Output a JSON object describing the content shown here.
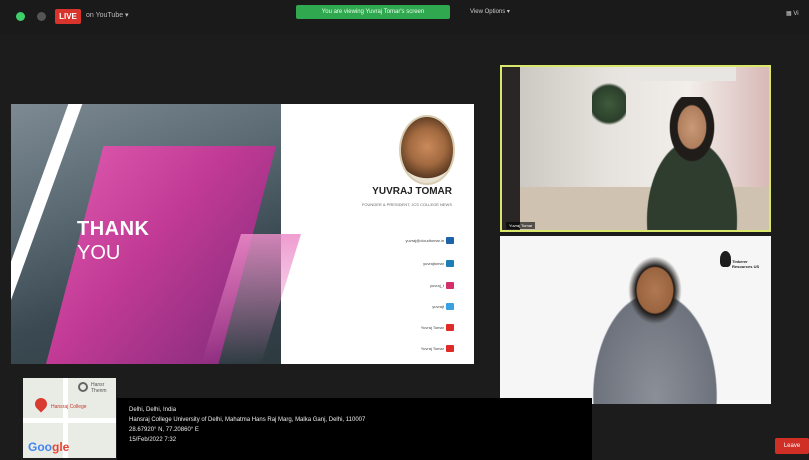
{
  "topbar": {
    "live_badge": "LIVE",
    "live_target": "on YouTube ▾",
    "viewing_banner": "You are viewing Yuvraj Tomar's screen",
    "view_options": "View Options ▾",
    "right_label": "Vi",
    "colors": {
      "green_dot": "#3ecf6b",
      "red_badge": "#d9342b",
      "banner": "#2fa84f"
    }
  },
  "slide": {
    "thank": "THANK",
    "you": "YOU",
    "name": "YUVRAJ TOMAR",
    "role": "FOUNDER & PRESIDENT, JCS COLLEGE NEWS",
    "contacts": [
      {
        "text": "yuvraj@cloudtomar.in",
        "icon": "linkedin-icon",
        "color": "#1d63a8"
      },
      {
        "text": "yuvrajtomar",
        "icon": "linkedin-icon",
        "color": "#1d7eb5"
      },
      {
        "text": "yuvraj_t",
        "icon": "instagram-icon",
        "color": "#d2306b"
      },
      {
        "text": "yuvrajt",
        "icon": "twitter-icon",
        "color": "#3aa0e4"
      },
      {
        "text": "Yuvraj Tomar",
        "icon": "youtube-icon",
        "color": "#e02a25"
      },
      {
        "text": "Yuvraj Tomar",
        "icon": "youtube-icon",
        "color": "#e02a25"
      }
    ]
  },
  "participants": {
    "tile1_label": "Yuvraj Tomar",
    "tile1_border": "#d9e76a",
    "tile2_logo_text": "Tinkerer\nResources US"
  },
  "map": {
    "place1": "Hansraj College",
    "place2": "Hansr Thenm",
    "brand_g1": "Goo",
    "brand_g2": "gle"
  },
  "geotag": {
    "line1": "Delhi, Delhi, India",
    "line2": "Hansraj College University of Delhi, Mahatma Hans Raj Marg, Malka Ganj, Delhi, 110007",
    "line3": "28.67920° N, 77.20860° E",
    "line4": "15/Feb/2022 7:32"
  },
  "leave_label": "Leave"
}
